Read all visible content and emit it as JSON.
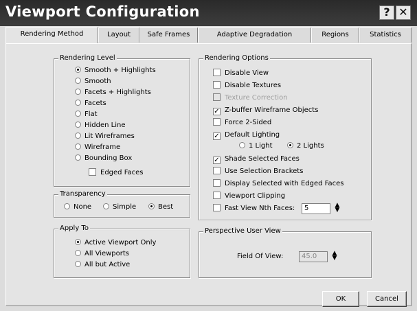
{
  "window": {
    "title": "Viewport Configuration",
    "help_label": "?",
    "close_label": "✕"
  },
  "tabs": [
    "Rendering Method",
    "Layout",
    "Safe Frames",
    "Adaptive Degradation",
    "Regions",
    "Statistics"
  ],
  "rendering_level": {
    "title": "Rendering Level",
    "options": [
      "Smooth + Highlights",
      "Smooth",
      "Facets + Highlights",
      "Facets",
      "Flat",
      "Hidden Line",
      "Lit Wireframes",
      "Wireframe",
      "Bounding Box"
    ],
    "selected": "Smooth + Highlights",
    "edged_faces": {
      "label": "Edged Faces",
      "checked": false
    }
  },
  "transparency": {
    "title": "Transparency",
    "options": [
      "None",
      "Simple",
      "Best"
    ],
    "selected": "Best"
  },
  "apply_to": {
    "title": "Apply To",
    "options": [
      "Active Viewport Only",
      "All Viewports",
      "All but Active"
    ],
    "selected": "Active Viewport Only"
  },
  "rendering_options": {
    "title": "Rendering Options",
    "disable_view": {
      "label": "Disable View",
      "checked": false
    },
    "disable_textures": {
      "label": "Disable Textures",
      "checked": false
    },
    "texture_correction": {
      "label": "Texture Correction",
      "checked": false,
      "disabled": true
    },
    "zbuffer_wireframe": {
      "label": "Z-buffer Wireframe Objects",
      "checked": true
    },
    "force_2sided": {
      "label": "Force 2-Sided",
      "checked": false
    },
    "default_lighting": {
      "label": "Default Lighting",
      "checked": true
    },
    "lights": {
      "options": [
        "1 Light",
        "2 Lights"
      ],
      "selected": "2 Lights"
    },
    "shade_selected": {
      "label": "Shade Selected Faces",
      "checked": true
    },
    "selection_brackets": {
      "label": "Use Selection Brackets",
      "checked": false
    },
    "display_edged": {
      "label": "Display Selected with Edged Faces",
      "checked": false
    },
    "viewport_clipping": {
      "label": "Viewport Clipping",
      "checked": false
    },
    "fast_view": {
      "label": "Fast View Nth Faces:",
      "checked": false,
      "value": "5"
    }
  },
  "perspective": {
    "title": "Perspective User View",
    "fov_label": "Field Of View:",
    "fov_value": "45.0"
  },
  "buttons": {
    "ok": "OK",
    "cancel": "Cancel"
  }
}
